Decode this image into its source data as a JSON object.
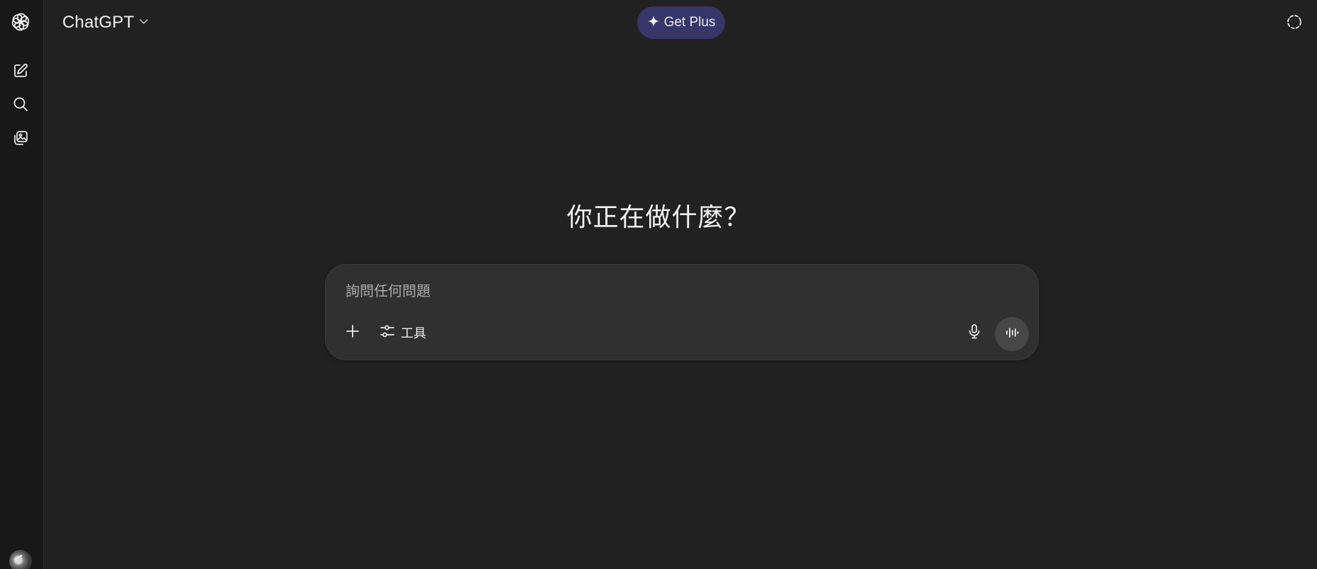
{
  "sidebar": {
    "logo_icon": "openai-logo-icon",
    "items": [
      {
        "name": "new-chat",
        "icon": "edit-icon"
      },
      {
        "name": "search-chats",
        "icon": "search-icon"
      },
      {
        "name": "library",
        "icon": "images-icon"
      }
    ],
    "avatar_icon": "user-avatar"
  },
  "header": {
    "model_name": "ChatGPT",
    "model_icon": "chevron-down-icon",
    "get_plus_label": "Get Plus",
    "get_plus_icon": "sparkle-icon",
    "temporary_chat_icon": "dashed-circle-icon"
  },
  "main": {
    "headline": "你正在做什麼？"
  },
  "composer": {
    "placeholder": "詢問任何問題",
    "value": "",
    "tools_label": "工具",
    "attach_icon": "plus-icon",
    "tools_icon": "sliders-icon",
    "mic_icon": "microphone-icon",
    "voice_icon": "voice-waveform-icon"
  },
  "colors": {
    "background": "#212121",
    "sidebar": "#181818",
    "composer": "#303030",
    "get_plus_bg": "#373669",
    "voice_button_bg": "#474747",
    "text": "#ececec",
    "placeholder": "#a9a9a9"
  }
}
